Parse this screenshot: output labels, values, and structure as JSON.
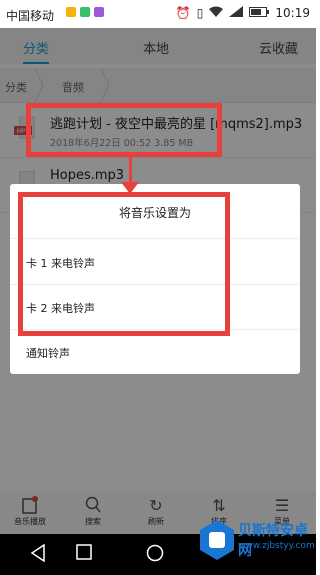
{
  "status_bar": {
    "carrier": "中国移动",
    "time": "10:19",
    "badge_colors": [
      "#f5b400",
      "#39c06b",
      "#9b59d6"
    ]
  },
  "tabs": [
    {
      "label": "分类",
      "active": true
    },
    {
      "label": "本地",
      "active": false
    },
    {
      "label": "云收藏",
      "active": false
    }
  ],
  "breadcrumb": [
    "分类",
    "音频"
  ],
  "files": [
    {
      "name": "逃跑计划 - 夜空中最亮的星 [mqms2].mp3",
      "meta": "2018年6月22日 00:52 3.85 MB",
      "icon": "mp3-file-icon",
      "icon_label": "MP3"
    },
    {
      "name": "Hopes.mp3",
      "meta": "",
      "icon": "music-file-icon"
    }
  ],
  "dialog": {
    "title": "将音乐设置为",
    "options": [
      "卡 1 来电铃声",
      "卡 2 来电铃声",
      "通知铃声"
    ]
  },
  "toolbar": [
    {
      "label": "音乐播放",
      "icon": "music-player-icon",
      "badge": true
    },
    {
      "label": "搜索",
      "icon": "search-icon"
    },
    {
      "label": "刷新",
      "icon": "refresh-icon"
    },
    {
      "label": "排序",
      "icon": "sort-icon"
    },
    {
      "label": "菜单",
      "icon": "menu-icon"
    }
  ],
  "nav": [
    "back-icon",
    "home-icon",
    "recents-icon"
  ],
  "watermark": {
    "title": "贝斯特安卓网",
    "url": "www.zjbstyy.com"
  },
  "annotation_color": "#e8403c",
  "accent_color": "#1aa1d9"
}
